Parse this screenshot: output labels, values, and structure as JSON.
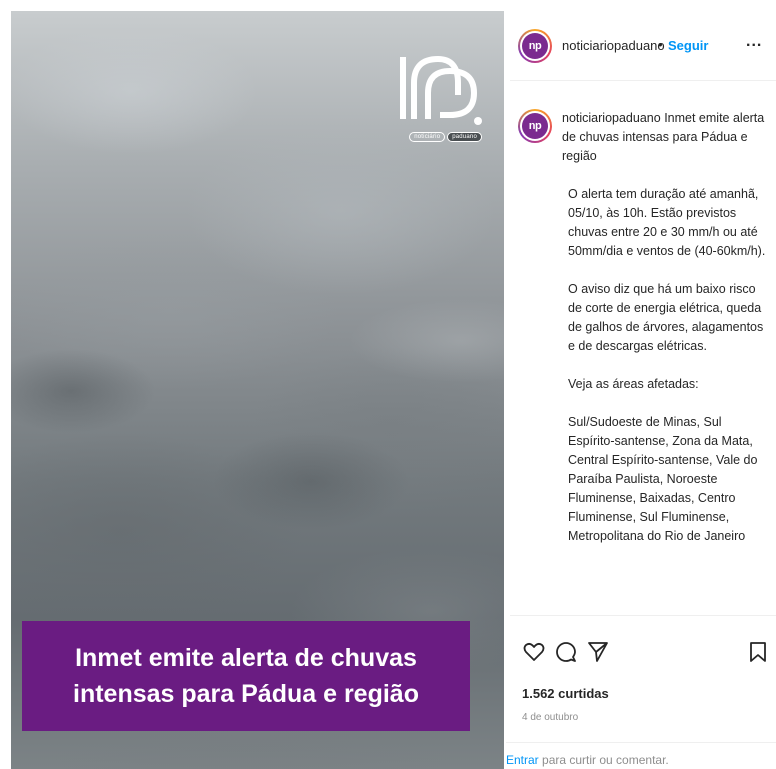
{
  "post": {
    "username": "noticiariopaduano",
    "separator": "•",
    "follow_label": "Seguir",
    "more_label": "...",
    "avatar_text": "np"
  },
  "image": {
    "logo_tag_1": "noticiário",
    "logo_tag_2": "paduano",
    "banner_text": "Inmet emite alerta de chuvas intensas para Pádua e região"
  },
  "caption": {
    "username": "noticiariopaduano",
    "title": "Inmet emite alerta de chuvas intensas para Pádua e região",
    "paragraph_1": "O alerta tem duração até amanhã, 05/10, às 10h. Estão previstos chuvas entre 20 e 30 mm/h ou até 50mm/dia e ventos de (40-60km/h).",
    "paragraph_2": "O aviso diz que há um baixo risco de corte de energia elétrica, queda de galhos de árvores, alagamentos e de descargas elétricas.",
    "paragraph_3": "Veja as áreas afetadas:",
    "paragraph_4": "Sul/Sudoeste de Minas, Sul Espírito-santense, Zona da Mata, Central Espírito-santense, Vale do Paraíba Paulista, Noroeste Fluminense, Baixadas, Centro Fluminense, Sul Fluminense, Metropolitana do Rio de Janeiro"
  },
  "actions": {
    "icons": [
      "heart-icon",
      "comment-icon",
      "share-icon",
      "bookmark-icon"
    ],
    "likes": "1.562 curtidas",
    "date": "4 de outubro",
    "login_link": "Entrar",
    "login_text": " para curtir ou comentar."
  },
  "colors": {
    "banner": "#6a1c82",
    "follow": "#0095f6",
    "avatar": "#7b2a8f"
  }
}
